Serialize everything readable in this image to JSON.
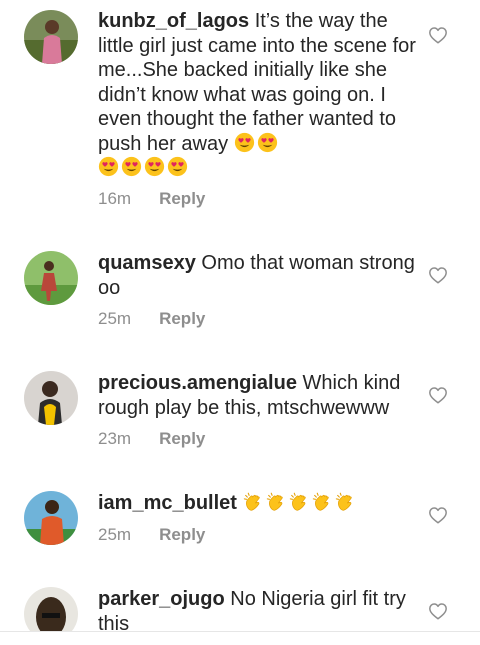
{
  "comments": [
    {
      "username": "kunbz_of_lagos",
      "text": " It’s the way the little girl just came into the scene for me...She backed initially like she didn’t know what was going on. I even thought the father wanted to push her away",
      "emoji_line": "😍😍😍😍",
      "trailing_emoji": "😍😍",
      "time": "16m",
      "reply_label": "Reply"
    },
    {
      "username": "quamsexy",
      "text": " Omo that woman strong oo",
      "time": "25m",
      "reply_label": "Reply"
    },
    {
      "username": "precious.amengialue",
      "text": " Which kind rough play be this, mtschwewww",
      "time": "23m",
      "reply_label": "Reply"
    },
    {
      "username": "iam_mc_bullet",
      "text": " ",
      "emoji_text": "👏👏👏👏👏",
      "time": "25m",
      "reply_label": "Reply"
    },
    {
      "username": "parker_ojugo",
      "text": " No Nigeria girl fit try this"
    }
  ],
  "icons": {
    "like": "heart-outline-icon",
    "heart_eyes": "heart-eyes-emoji",
    "clap": "clapping-hands-emoji"
  },
  "colors": {
    "text": "#262626",
    "meta": "#8e8e8e",
    "background": "#ffffff"
  }
}
